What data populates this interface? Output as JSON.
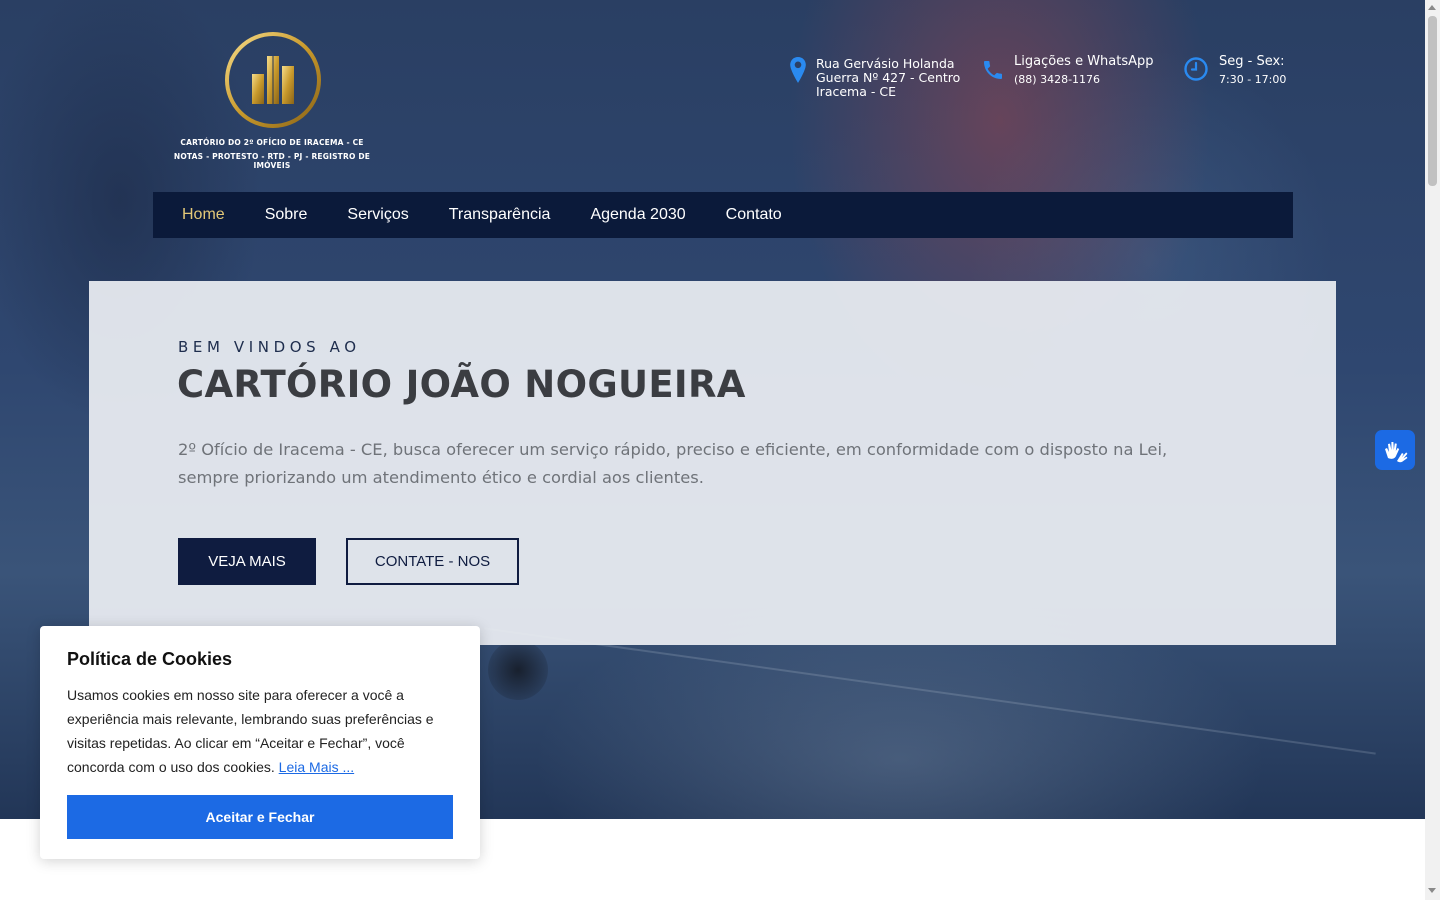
{
  "logo": {
    "line1": "CARTÓRIO DO 2º OFÍCIO DE IRACEMA - CE",
    "line2": "NOTAS - PROTESTO - RTD - PJ - REGISTRO DE IMÓVEIS",
    "icon": "building-emblem-icon"
  },
  "header_info": {
    "address": {
      "icon": "map-pin-icon",
      "line1": "Rua Gervásio Holanda",
      "line2": "Guerra Nº 427 - Centro",
      "line3": "Iracema - CE"
    },
    "phone": {
      "icon": "phone-icon",
      "title": "Ligações e WhatsApp",
      "number": "(88) 3428-1176"
    },
    "hours": {
      "icon": "clock-icon",
      "title": "Seg - Sex:",
      "time": "7:30 - 17:00"
    },
    "icon_color": "#2a8af0"
  },
  "nav": {
    "items": [
      {
        "label": "Home",
        "active": true
      },
      {
        "label": "Sobre"
      },
      {
        "label": "Serviços"
      },
      {
        "label": "Transparência"
      },
      {
        "label": "Agenda 2030"
      },
      {
        "label": "Contato"
      }
    ],
    "active_color": "#e3c878",
    "background": "#0b1a3a"
  },
  "hero": {
    "kicker": "BEM VINDOS AO",
    "title": "CARTÓRIO JOÃO NOGUEIRA",
    "description": "2º Ofício de Iracema - CE, busca oferecer um serviço rápido, preciso e eficiente, em conformidade com o disposto na Lei, sempre priorizando um atendimento ético e cordial aos clientes.",
    "primary_button": "VEJA MAIS",
    "secondary_button": "CONTATE - NOS"
  },
  "accessibility": {
    "icon": "sign-language-hands-icon",
    "color": "#1c6ae4"
  },
  "cookie_banner": {
    "title": "Política de Cookies",
    "text": "Usamos cookies em nosso site para oferecer a você a experiência mais relevante, lembrando suas preferências e visitas repetidas. Ao clicar em “Aceitar e Fechar”, você concorda com o uso dos cookies.",
    "link": "Leia Mais ...",
    "accept_button": "Aceitar e Fechar",
    "accent": "#1c6ae4"
  }
}
